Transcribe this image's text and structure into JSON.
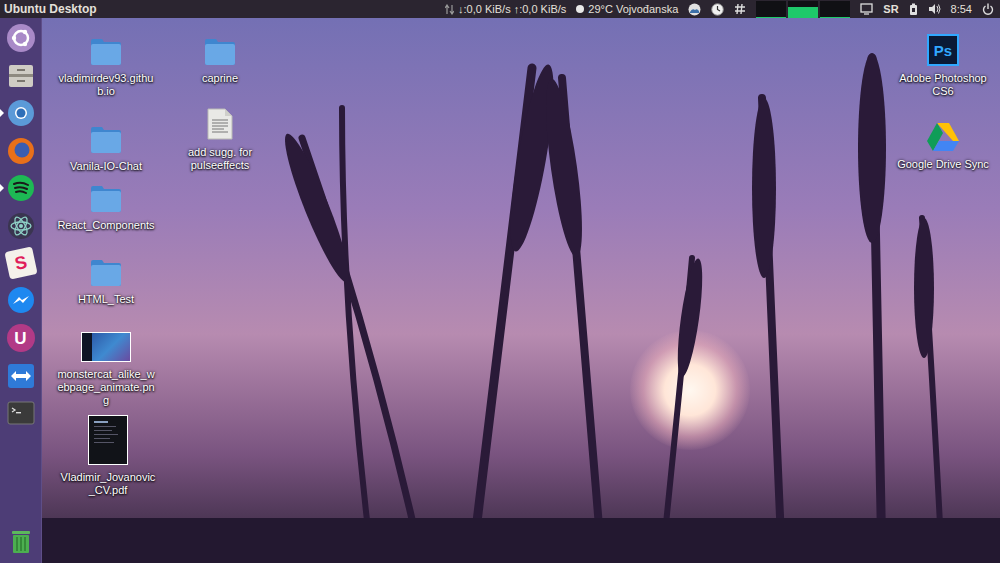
{
  "top_bar": {
    "title": "Ubuntu Desktop",
    "network": "↓:0,0 KiB/s ↑:0,0 KiB/s",
    "weather": "29°C Vojvođanska",
    "monitor_levels": [
      0.05,
      0.6,
      0.05
    ],
    "keyboard": "SR",
    "clock": "8:54"
  },
  "launcher": {
    "items": [
      {
        "kind": "dash",
        "running": false
      },
      {
        "kind": "files",
        "running": false
      },
      {
        "kind": "chromium",
        "running": true
      },
      {
        "kind": "firefox",
        "running": false
      },
      {
        "kind": "spotify",
        "running": true
      },
      {
        "kind": "atom",
        "running": false
      },
      {
        "kind": "slack",
        "running": false,
        "glyph": "S"
      },
      {
        "kind": "messenger",
        "running": false
      },
      {
        "kind": "software",
        "running": false,
        "glyph": "U"
      },
      {
        "kind": "teamviewer",
        "running": false
      },
      {
        "kind": "terminal",
        "running": false
      }
    ],
    "trash": {
      "kind": "trash",
      "running": false
    }
  },
  "desktop": {
    "items": [
      {
        "label": "vladimirdev93.github.io",
        "kind": "folder"
      },
      {
        "label": "Vanila-IO-Chat",
        "kind": "folder"
      },
      {
        "label": "React_Components",
        "kind": "folder"
      },
      {
        "label": "HTML_Test",
        "kind": "folder"
      },
      {
        "label": "monstercat_alike_webpage_animate.png",
        "kind": "image"
      },
      {
        "label": "Vladimir_Jovanovic_CV.pdf",
        "kind": "pdf"
      },
      {
        "label": "caprine",
        "kind": "folder"
      },
      {
        "label": "add sugg. for pulseeffects",
        "kind": "text"
      },
      {
        "label": "Adobe Photoshop CS6",
        "kind": "photoshop",
        "glyph": "Ps"
      },
      {
        "label": "Google Drive Sync",
        "kind": "gdrive"
      }
    ]
  }
}
